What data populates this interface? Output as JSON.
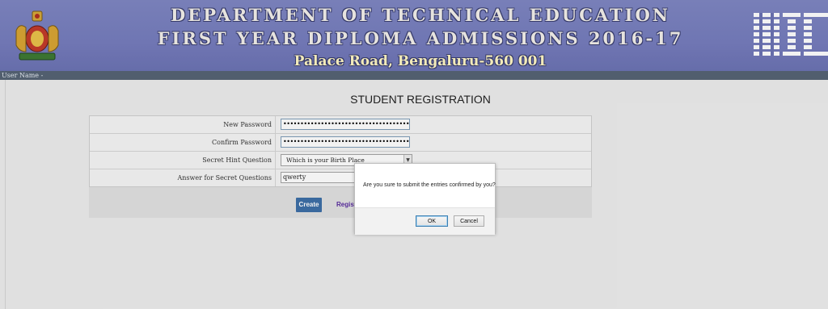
{
  "header": {
    "title_line1": "DEPARTMENT OF TECHNICAL EDUCATION",
    "title_line2": "FIRST YEAR DIPLOMA ADMISSIONS 2016-17",
    "title_line3": "Palace Road, Bengaluru-560 001",
    "emblem_icon": "state-emblem-icon",
    "nic_logo_text": "NIC"
  },
  "user_bar": {
    "label": "User Name -"
  },
  "page": {
    "title": "STUDENT REGISTRATION"
  },
  "form": {
    "new_password_label": "New Password",
    "new_password_value": "••••••••••••••••••••••••••••••••••••••",
    "confirm_password_label": "Confirm Password",
    "confirm_password_value": "••••••••••••••••••••••••••••••••••••••",
    "secret_question_label": "Secret Hint Question",
    "secret_question_value": "Which is your Birth Place",
    "secret_answer_label": "Answer for Secret Questions",
    "secret_answer_value": "qwerty"
  },
  "actions": {
    "create_label": "Create",
    "register_label": "Regist"
  },
  "dialog": {
    "message": "Are you sure to submit the entries confirmed by you?",
    "ok_label": "OK",
    "cancel_label": "Cancel"
  },
  "colors": {
    "banner": "#767dbd",
    "user_bar": "#566474",
    "create_button": "#3e6fa7"
  }
}
